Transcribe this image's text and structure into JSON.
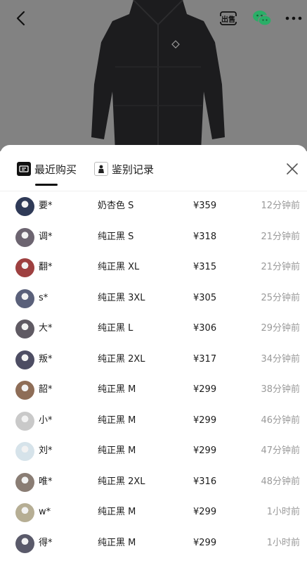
{
  "header": {
    "sell_icon_text": "出售",
    "brand_color": "#2aae67",
    "hero_bg": "#828282"
  },
  "tabs": [
    {
      "label": "最近购买",
      "icon": "recent-purchase-icon",
      "active": true
    },
    {
      "label": "鉴别记录",
      "icon": "authentication-icon",
      "active": false
    }
  ],
  "records": [
    {
      "name": "要*",
      "spec": "奶杏色 S",
      "price": "¥359",
      "time": "12分钟前",
      "avatar_color": "#2f3a57"
    },
    {
      "name": "调*",
      "spec": "纯正黑 S",
      "price": "¥318",
      "time": "21分钟前",
      "avatar_color": "#6c6470"
    },
    {
      "name": "翻*",
      "spec": "纯正黑 XL",
      "price": "¥315",
      "time": "21分钟前",
      "avatar_color": "#9e4040"
    },
    {
      "name": "s*",
      "spec": "纯正黑 3XL",
      "price": "¥305",
      "time": "25分钟前",
      "avatar_color": "#5a607a"
    },
    {
      "name": "大*",
      "spec": "纯正黑 L",
      "price": "¥306",
      "time": "29分钟前",
      "avatar_color": "#5f5a63"
    },
    {
      "name": "叛*",
      "spec": "纯正黑 2XL",
      "price": "¥317",
      "time": "34分钟前",
      "avatar_color": "#4d4d63"
    },
    {
      "name": "韶*",
      "spec": "纯正黑 M",
      "price": "¥299",
      "time": "38分钟前",
      "avatar_color": "#8e6d57"
    },
    {
      "name": "小*",
      "spec": "纯正黑 M",
      "price": "¥299",
      "time": "46分钟前",
      "avatar_color": "#c9c9c9"
    },
    {
      "name": "刘*",
      "spec": "纯正黑 M",
      "price": "¥299",
      "time": "47分钟前",
      "avatar_color": "#d6e3ea"
    },
    {
      "name": "唯*",
      "spec": "纯正黑 2XL",
      "price": "¥316",
      "time": "48分钟前",
      "avatar_color": "#8a7d74"
    },
    {
      "name": "w*",
      "spec": "纯正黑 M",
      "price": "¥299",
      "time": "1小时前",
      "avatar_color": "#b6ae94"
    },
    {
      "name": "得*",
      "spec": "纯正黑 M",
      "price": "¥299",
      "time": "1小时前",
      "avatar_color": "#5a5a6a"
    }
  ]
}
